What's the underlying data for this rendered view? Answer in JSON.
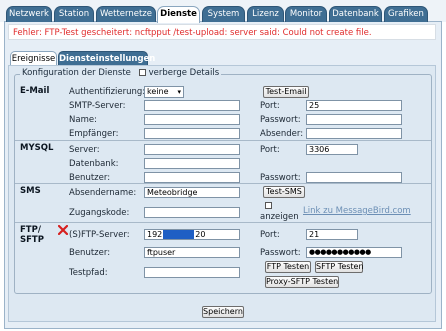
{
  "top_tabs": [
    "Netzwerk",
    "Station",
    "Wetternetze",
    "Dienste",
    "System",
    "Lizenz",
    "Monitor",
    "Datenbank",
    "Grafiken"
  ],
  "active_tab": "Dienste",
  "error_message": "Fehler: FTP-Test gescheitert: ncftpput /test-upload: server said: Could not create file.",
  "sub_tabs": [
    "Ereignisse",
    "Diensteinstellungen"
  ],
  "active_sub_tab": "Diensteinstellungen",
  "config": {
    "legend": "Konfiguration der Dienste",
    "hide_details_label": "verberge Details"
  },
  "email": {
    "section": "E-Mail",
    "auth_label": "Authentifizierung:",
    "auth_value": "keine",
    "smtp_label": "SMTP-Server:",
    "smtp_value": "",
    "name_label": "Name:",
    "name_value": "",
    "recipient_label": "Empfänger:",
    "recipient_value": "",
    "test_button": "Test-Email",
    "port_label": "Port:",
    "port_value": "25",
    "password_label": "Passwort:",
    "password_value": "",
    "sender_label": "Absender:",
    "sender_value": ""
  },
  "mysql": {
    "section": "MYSQL",
    "server_label": "Server:",
    "server_value": "",
    "db_label": "Datenbank:",
    "db_value": "",
    "user_label": "Benutzer:",
    "user_value": "",
    "port_label": "Port:",
    "port_value": "3306",
    "password_label": "Passwort:",
    "password_value": ""
  },
  "sms": {
    "section": "SMS",
    "sender_label": "Absendername:",
    "sender_value": "Meteobridge",
    "code_label": "Zugangskode:",
    "code_value": "",
    "test_button": "Test-SMS",
    "show_label": "anzeigen",
    "link": "Link zu MessageBird.com"
  },
  "ftp": {
    "section_line1": "FTP/",
    "section_line2": "SFTP",
    "server_label": "(S)FTP-Server:",
    "server_prefix": "192",
    "server_suffix": "20",
    "user_label": "Benutzer:",
    "user_value": "ftpuser",
    "path_label": "Testpfad:",
    "path_value": "",
    "port_label": "Port:",
    "port_value": "21",
    "password_label": "Passwort:",
    "password_value": "●●●●●●●●●●●",
    "ftp_test_button": "FTP Testen",
    "sftp_test_button": "SFTP Testen",
    "proxy_test_button": "Proxy-SFTP Testen"
  },
  "save_button": "Speichern",
  "colors": {
    "tab_bg": "#3f6e93",
    "error_text": "#e02b2b",
    "panel_bg": "#dde8f2",
    "link": "#6c8fb5"
  }
}
